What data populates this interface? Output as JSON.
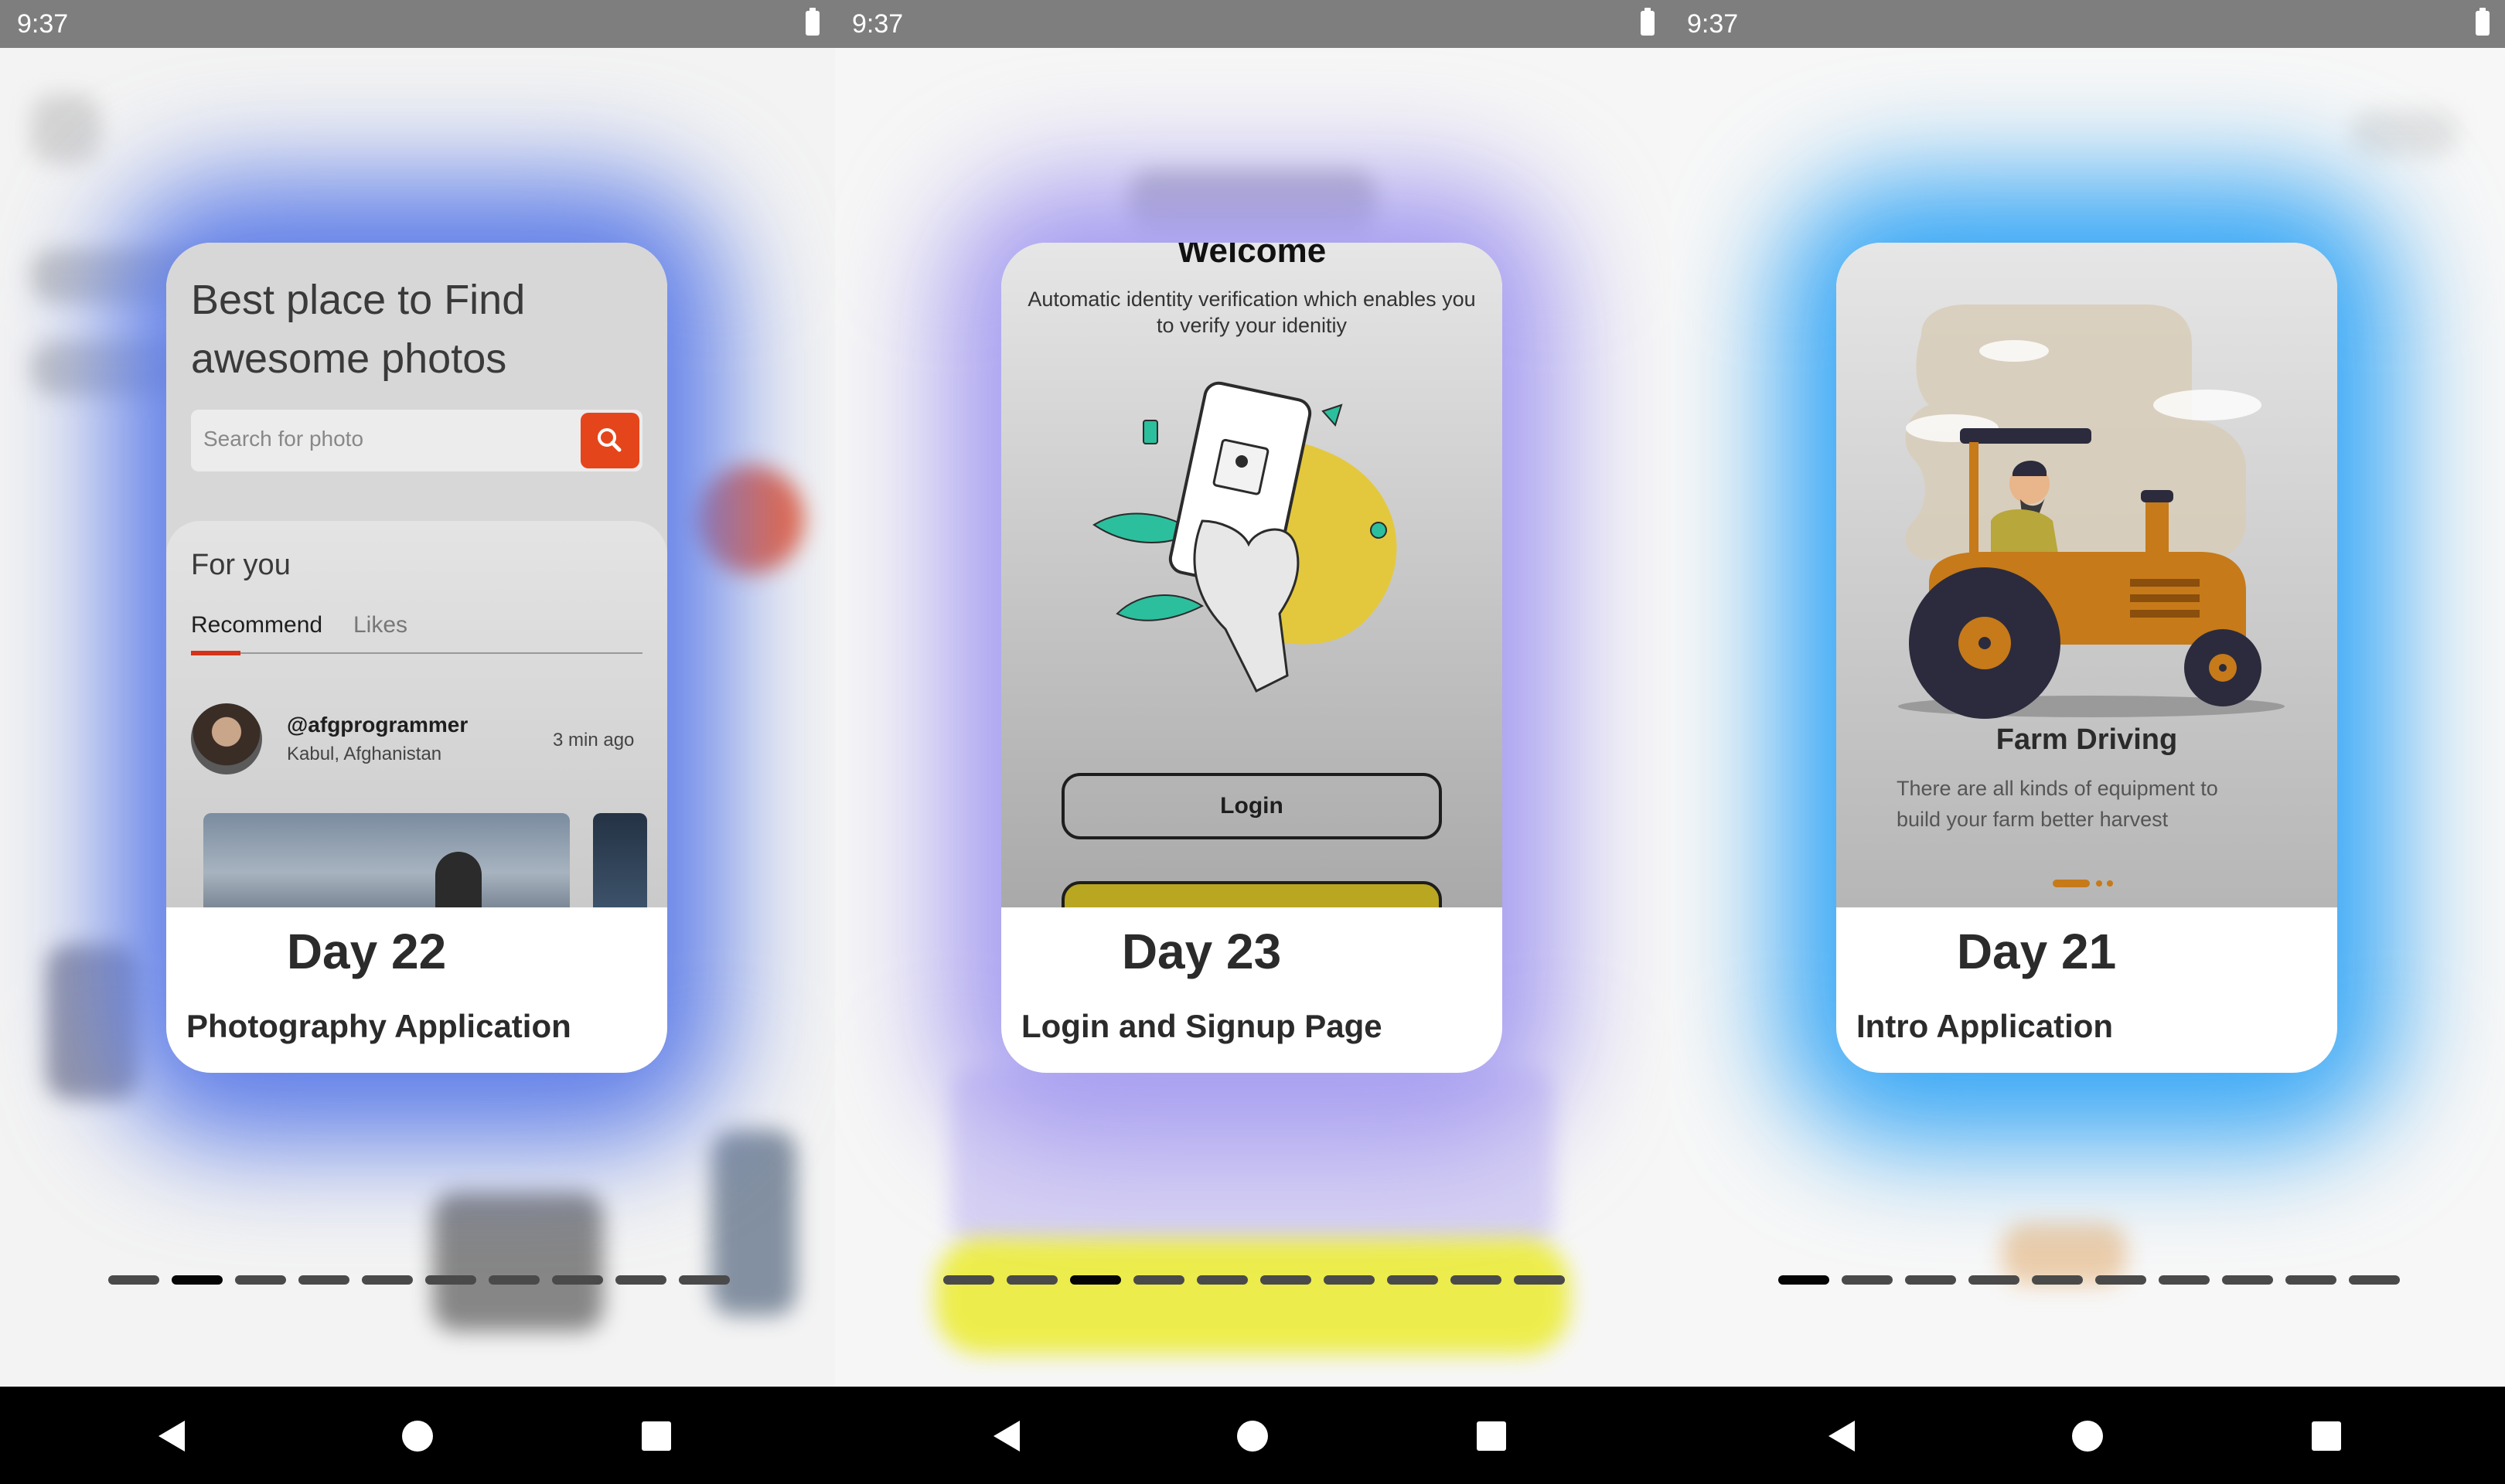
{
  "status_time": "9:37",
  "screens": [
    {
      "glow_color": "#5f7ee8",
      "day": "Day 22",
      "title": "Photography Application",
      "preview": {
        "heading": "Best place to Find awesome photos",
        "search_placeholder": "Search for photo",
        "section_title": "For you",
        "tabs": [
          "Recommend",
          "Likes"
        ],
        "user_handle": "@afgprogrammer",
        "user_location": "Kabul, Afghanistan",
        "post_time": "3 min ago",
        "accent": "#e5451b"
      },
      "active_dot": 1
    },
    {
      "glow_color": "#a69df0",
      "day": "Day 23",
      "title": "Login and Signup Page",
      "preview": {
        "heading": "Welcome",
        "subtitle": "Automatic identity verification which enables you to verify your idenitiy",
        "login_label": "Login",
        "accent": "#e8d43e"
      },
      "active_dot": 2
    },
    {
      "glow_color": "#3aa8f5",
      "day": "Day 21",
      "title": "Intro Application",
      "preview": {
        "heading": "Farm Driving",
        "subtitle": "There are all kinds of equipment to build your farm better harvest",
        "accent": "#c67a19"
      },
      "active_dot": 0
    }
  ]
}
